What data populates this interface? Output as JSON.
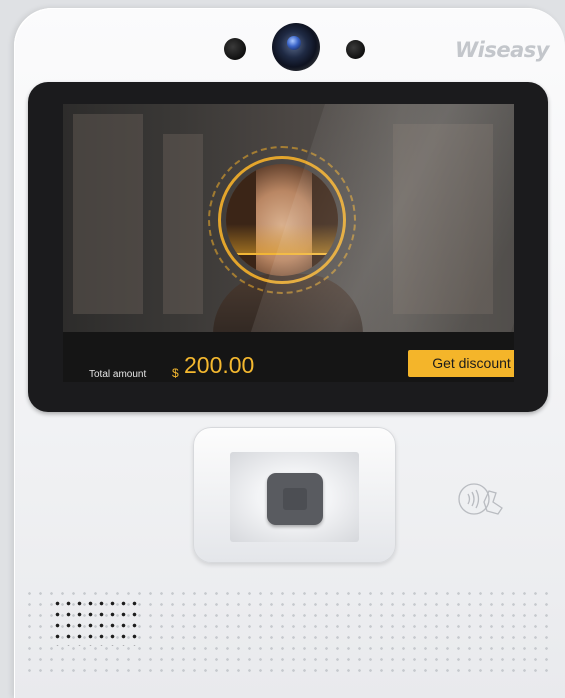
{
  "device": {
    "brand": "Wiseasy"
  },
  "screen": {
    "total_label": "Total amount",
    "currency_symbol": "$",
    "amount": "200.00",
    "discount_button": "Get discount"
  },
  "icons": {
    "camera": "camera-icon",
    "nfc": "contactless-nfc-icon",
    "fingerprint_sensor": "fingerprint-icon"
  },
  "colors": {
    "accent": "#f4b52a",
    "screen_bar": "#151515",
    "device_body": "#f3f4f6"
  }
}
